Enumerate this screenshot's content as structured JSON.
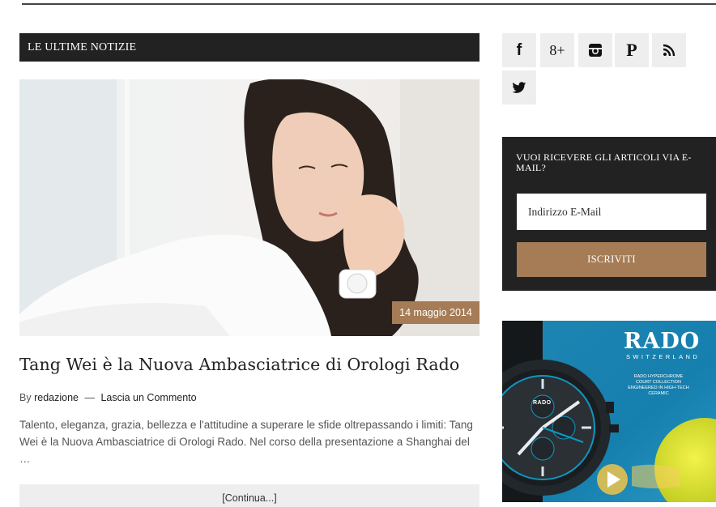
{
  "main": {
    "section_title": "LE ULTIME NOTIZIE",
    "post": {
      "date": "14 maggio 2014",
      "title": "Tang Wei è la Nuova Ambasciatrice di Orologi Rado",
      "meta_by": "By",
      "author": "redazione",
      "separator": "—",
      "comment_link": "Lascia un Commento",
      "excerpt": "Talento, eleganza, grazia, bellezza e l'attitudine a superare le sfide oltrepassando i limiti: Tang Wei è la Nuova Ambasciatrice di Orologi Rado. Nel corso della presentazione a Shanghai del …",
      "continue_label": "[Continua...]"
    }
  },
  "sidebar": {
    "social": [
      {
        "icon": "facebook-icon",
        "glyph": "f"
      },
      {
        "icon": "google-plus-icon",
        "glyph": "8+"
      },
      {
        "icon": "instagram-icon",
        "glyph": ""
      },
      {
        "icon": "pinterest-icon",
        "glyph": "P"
      },
      {
        "icon": "rss-icon",
        "glyph": ""
      },
      {
        "icon": "twitter-icon",
        "glyph": ""
      }
    ],
    "subscribe": {
      "title": "VUOI RICEVERE GLI ARTICOLI VIA E-MAIL?",
      "email_placeholder": "Indirizzo E-Mail",
      "button_label": "ISCRIVITI"
    },
    "ad": {
      "brand": "RADO",
      "brand_sub": "SWITZERLAND",
      "tagline_1": "RADO HYPERCHROME",
      "tagline_2": "COURT COLLECTION",
      "tagline_3": "ENGINEERED IN HIGH-TECH CERAMIC",
      "watch_logo": "RADO"
    }
  },
  "colors": {
    "dark": "#222222",
    "accent": "#a57c55",
    "light_bg": "#eeeeee",
    "ad_blue": "#0e97c2"
  }
}
